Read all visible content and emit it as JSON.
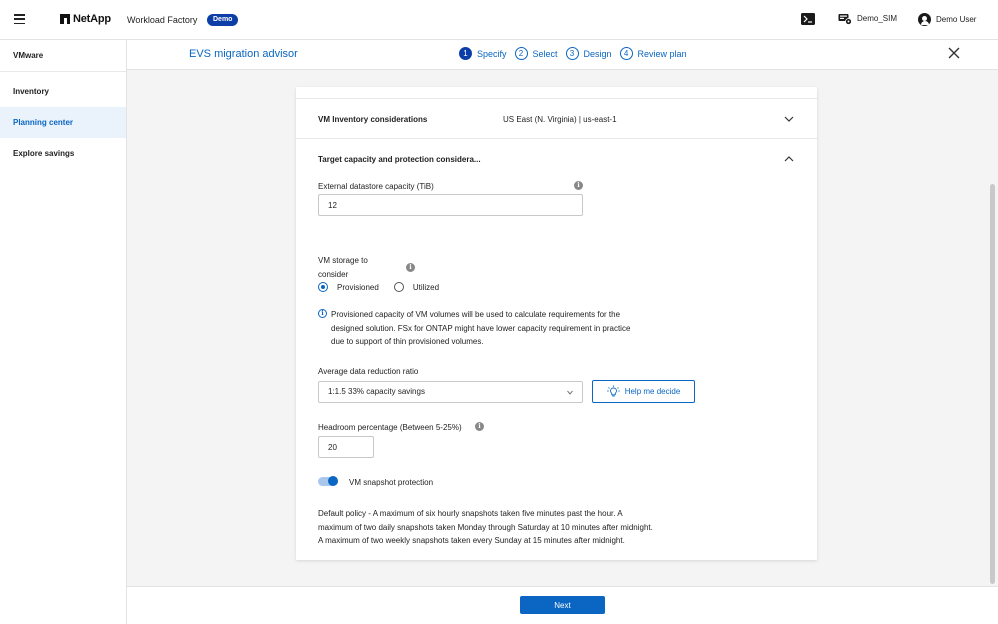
{
  "header": {
    "brand": "NetApp",
    "product": "Workload Factory",
    "badge": "Demo",
    "account": "Demo_SIM",
    "user": "Demo User"
  },
  "sidebar": {
    "items": [
      {
        "label": "VMware"
      },
      {
        "label": "Inventory"
      },
      {
        "label": "Planning center",
        "active": true
      },
      {
        "label": "Explore savings"
      }
    ]
  },
  "subheader": {
    "title": "EVS migration advisor",
    "steps": [
      {
        "num": "1",
        "label": "Specify",
        "active": true
      },
      {
        "num": "2",
        "label": "Select"
      },
      {
        "num": "3",
        "label": "Design"
      },
      {
        "num": "4",
        "label": "Review plan"
      }
    ]
  },
  "form": {
    "inventory_section": {
      "label": "VM Inventory considerations",
      "value": "US East (N. Virginia) | us-east-1"
    },
    "target_section": {
      "label": "Target capacity and protection considera..."
    },
    "external_datastore": {
      "label": "External datastore capacity (TiB)",
      "value": "12"
    },
    "vm_storage": {
      "label_line1": "VM storage to",
      "label_line2": "consider",
      "options": [
        "Provisioned",
        "Utilized"
      ],
      "selected": "Provisioned"
    },
    "storage_note": "Provisioned capacity of VM volumes will be used to calculate requirements for the designed solution. FSx for ONTAP might have lower capacity requirement in practice due to support of thin provisioned volumes.",
    "reduction_ratio": {
      "label": "Average data reduction ratio",
      "selected": "1:1.5 33% capacity savings",
      "help_label": "Help me decide"
    },
    "headroom": {
      "label": "Headroom percentage (Between 5-25%)",
      "value": "20"
    },
    "snapshot": {
      "label": "VM snapshot protection",
      "enabled": true,
      "policy_line1": "Default policy - A maximum of six hourly snapshots taken five minutes past the hour. A",
      "policy_line2": "maximum of two daily snapshots taken Monday through Saturday at 10 minutes after midnight.",
      "policy_line3": "A maximum of two weekly snapshots taken every Sunday at 15 minutes after midnight."
    }
  },
  "footer": {
    "next_label": "Next"
  },
  "colors": {
    "accent": "#0a66c2",
    "badge": "#0d3ea8"
  },
  "icons": [
    "hamburger-icon",
    "terminal-icon",
    "workspace-icon",
    "user-icon",
    "close-icon",
    "chevron-down-icon",
    "chevron-up-icon",
    "info-icon",
    "lightbulb-icon",
    "caret-down-icon"
  ]
}
